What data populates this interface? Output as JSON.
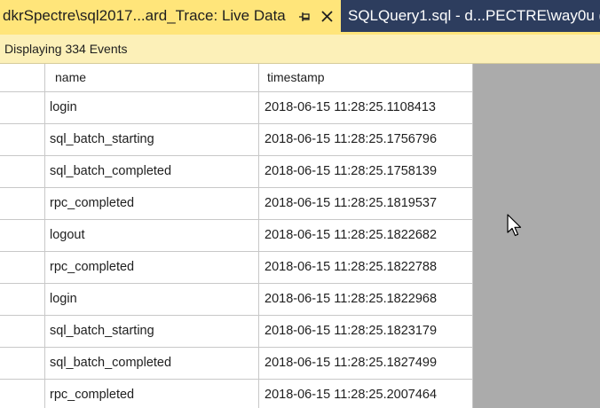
{
  "tabs": [
    {
      "label": "dkrSpectre\\sql2017...ard_Trace: Live Data",
      "active": true
    },
    {
      "label": "SQLQuery1.sql - d...PECTRE\\way0u (",
      "active": false
    }
  ],
  "info_bar": {
    "text": "Displaying 334 Events"
  },
  "grid": {
    "columns": [
      "name",
      "timestamp"
    ],
    "rows": [
      {
        "name": "login",
        "timestamp": "2018-06-15 11:28:25.1108413"
      },
      {
        "name": "sql_batch_starting",
        "timestamp": "2018-06-15 11:28:25.1756796"
      },
      {
        "name": "sql_batch_completed",
        "timestamp": "2018-06-15 11:28:25.1758139"
      },
      {
        "name": "rpc_completed",
        "timestamp": "2018-06-15 11:28:25.1819537"
      },
      {
        "name": "logout",
        "timestamp": "2018-06-15 11:28:25.1822682"
      },
      {
        "name": "rpc_completed",
        "timestamp": "2018-06-15 11:28:25.1822788"
      },
      {
        "name": "login",
        "timestamp": "2018-06-15 11:28:25.1822968"
      },
      {
        "name": "sql_batch_starting",
        "timestamp": "2018-06-15 11:28:25.1823179"
      },
      {
        "name": "sql_batch_completed",
        "timestamp": "2018-06-15 11:28:25.1827499"
      },
      {
        "name": "rpc_completed",
        "timestamp": "2018-06-15 11:28:25.2007464"
      }
    ]
  },
  "icons": {
    "pin": "pin-icon",
    "close": "close-icon",
    "cursor": "mouse-pointer-icon"
  },
  "colors": {
    "active_tab": "#ffe57a",
    "tab_strip": "#2d3d5e",
    "info_bar": "#fcf0b8",
    "empty_area": "#ababab"
  }
}
